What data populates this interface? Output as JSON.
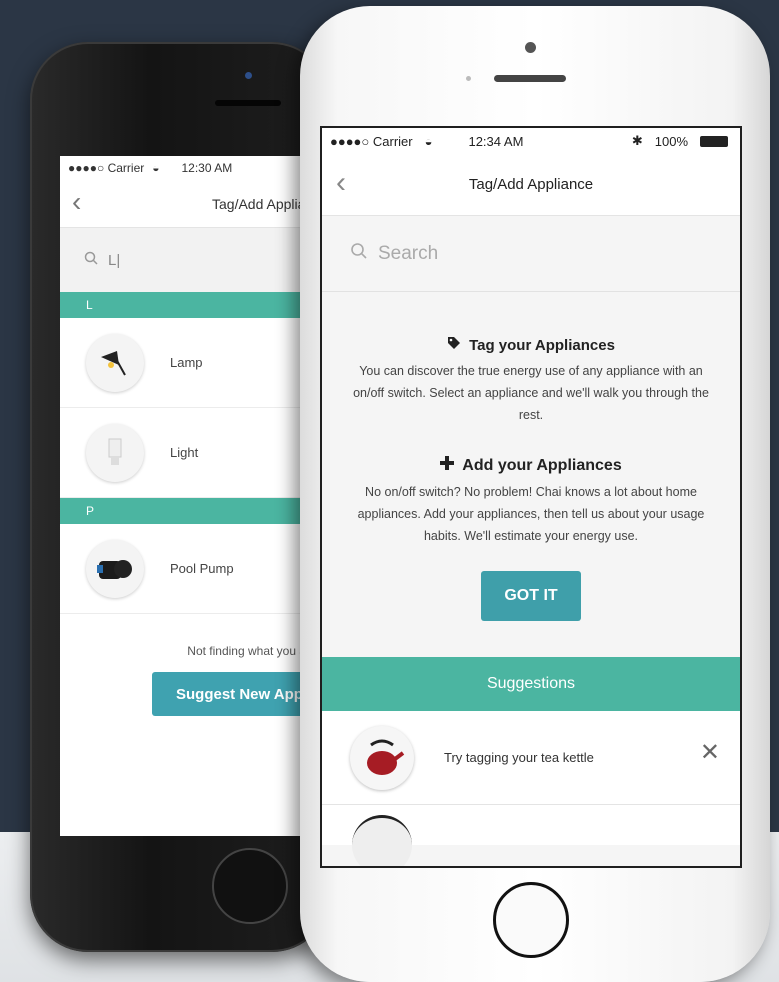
{
  "back_phone": {
    "status_bar": {
      "carrier": "●●●●○ Carrier",
      "time": "12:30 AM"
    },
    "nav_title": "Tag/Add Appliance",
    "search_value": "L|",
    "sections": [
      {
        "letter": "L",
        "items": [
          {
            "label": "Lamp",
            "icon": "lamp-icon"
          },
          {
            "label": "Light",
            "icon": "bulb-icon"
          }
        ]
      },
      {
        "letter": "P",
        "items": [
          {
            "label": "Pool Pump",
            "icon": "pump-icon"
          }
        ]
      }
    ],
    "not_finding": "Not finding what you are l",
    "suggest_button": "Suggest New Appli"
  },
  "front_phone": {
    "status_bar": {
      "carrier": "●●●●○ Carrier",
      "time": "12:34 AM",
      "battery": "100%"
    },
    "nav_title": "Tag/Add Appliance",
    "search_placeholder": "Search",
    "tag": {
      "title": "Tag your Appliances",
      "body": "You can discover the true energy use of any appliance with an on/off switch. Select an appliance and we'll walk you through the rest."
    },
    "add": {
      "title": "Add your Appliances",
      "body": "No on/off switch? No problem! Chai knows a lot about home appliances. Add your appliances, then tell us about your usage habits. We'll estimate your energy use."
    },
    "got_it": "GOT IT",
    "suggestions_label": "Suggestions",
    "suggestion": {
      "text": "Try tagging your tea kettle",
      "icon": "kettle-icon"
    }
  },
  "colors": {
    "teal": "#4bb5a1",
    "button_blue": "#3f9faa",
    "background": "#2b3645"
  }
}
